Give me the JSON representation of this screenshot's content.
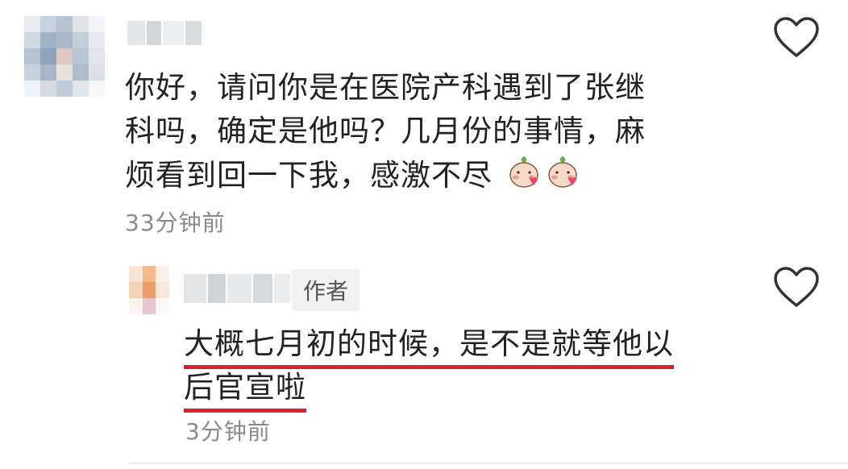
{
  "comment": {
    "text_lines": [
      "你好，请问你是在医院产科遇到了张继",
      "科吗，确定是他吗？几月份的事情，麻",
      "烦看到回一下我，感激不尽"
    ],
    "emoji_icons": [
      "blushing-peach-emoji",
      "blushing-peach-emoji"
    ],
    "timestamp": "33分钟前",
    "like_icon": "heart-outline-icon"
  },
  "reply": {
    "badge": "作者",
    "text_lines": [
      "大概七月初的时候，是不是就等他以",
      "后官宣啦"
    ],
    "underline_color": "#d6232f",
    "timestamp": "3分钟前",
    "like_icon": "heart-outline-icon"
  }
}
